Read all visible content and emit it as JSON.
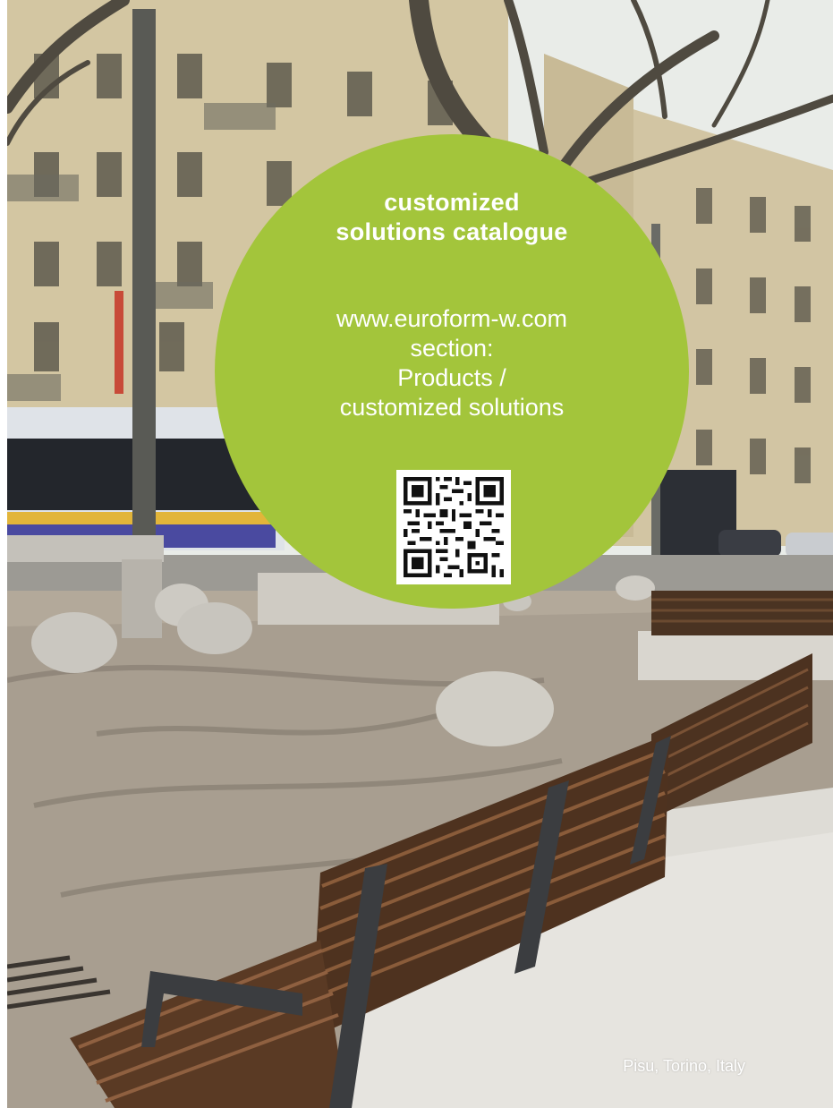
{
  "badge": {
    "title_lines": [
      "customized",
      "solutions catalogue"
    ],
    "body_lines": [
      "www.euroform-w.com",
      "section:",
      "Products /",
      "customized solutions"
    ],
    "color": "#a3c53b"
  },
  "qr_code": {
    "icon": "qr-code-icon"
  },
  "photo": {
    "caption": "Pisu, Torino, Italy"
  }
}
